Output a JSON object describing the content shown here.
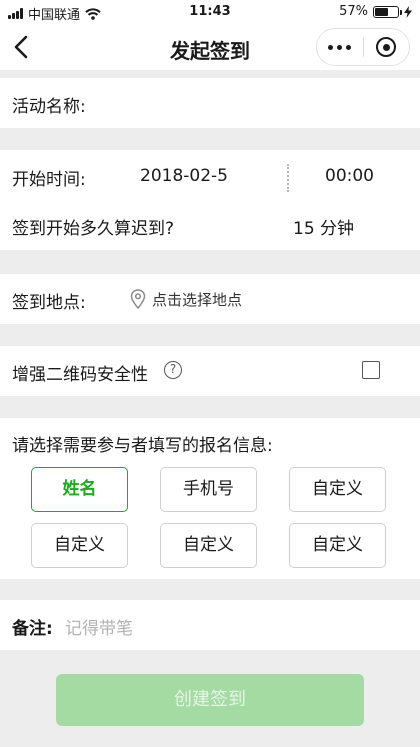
{
  "status_bar": {
    "carrier": "中国联通",
    "time": "11:43",
    "battery_percent": "57%",
    "battery_level": 0.57
  },
  "nav": {
    "title": "发起签到"
  },
  "form": {
    "activity_name_label": "活动名称:",
    "start_time_label": "开始时间:",
    "start_date": "2018-02-5",
    "start_time": "00:00",
    "late_label": "签到开始多久算迟到?",
    "late_value": "15 分钟",
    "location_label": "签到地点:",
    "location_placeholder": "点击选择地点",
    "qr_security_label": "增强二维码安全性",
    "info_prompt": "请选择需要参与者填写的报名信息:",
    "options": [
      "姓名",
      "手机号",
      "自定义",
      "自定义",
      "自定义",
      "自定义"
    ],
    "note_label": "备注:",
    "note_placeholder": "记得带笔"
  },
  "submit": {
    "label": "创建签到"
  },
  "colors": {
    "accent": "#1aad19",
    "button_disabled": "#a3dba2",
    "page_bg": "#ededed"
  },
  "icons": {
    "back": "chevron-left-icon",
    "more": "more-dots-icon",
    "close": "target-circle-icon",
    "location": "location-pin-icon",
    "help": "question-circle-icon"
  }
}
